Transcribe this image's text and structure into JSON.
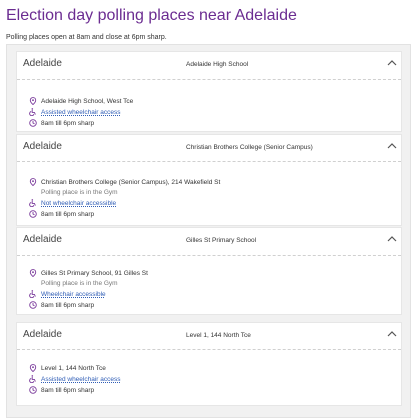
{
  "page": {
    "title": "Election day polling places near Adelaide",
    "subtitle": "Polling places open at 8am and close at 6pm sharp."
  },
  "places": [
    {
      "name": "Adelaide",
      "venue": "Adelaide High School",
      "address": "Adelaide High School, West Tce",
      "note": "",
      "access": "Assisted wheelchair access",
      "hours": "8am till 6pm sharp",
      "expanded": true
    },
    {
      "name": "Adelaide",
      "venue": "Christian Brothers College (Senior Campus)",
      "address": "Christian Brothers College (Senior Campus), 214 Wakefield St",
      "note": "Polling place is in the Gym",
      "access": "Not wheelchair accessible",
      "hours": "8am till 6pm sharp",
      "expanded": true
    },
    {
      "name": "Adelaide",
      "venue": "Gilles St Primary School",
      "address": "Gilles St Primary School, 91 Gilles St",
      "note": "Polling place is in the Gym",
      "access": "Wheelchair accessible",
      "hours": "8am till 6pm sharp",
      "expanded": true
    },
    {
      "name": "Adelaide",
      "venue": "Level 1, 144 North Tce",
      "address": "Level 1, 144 North Tce",
      "note": "",
      "access": "Assisted wheelchair access",
      "hours": "8am till 6pm sharp",
      "expanded": true
    }
  ],
  "colors": {
    "title": "#6b2c91",
    "icon": "#7a3a9b",
    "link": "#2f5db6"
  },
  "icons": {
    "location": "location-pin-icon",
    "accessibility": "wheelchair-icon",
    "hours": "clock-icon",
    "toggle": "chevron-up-icon"
  }
}
